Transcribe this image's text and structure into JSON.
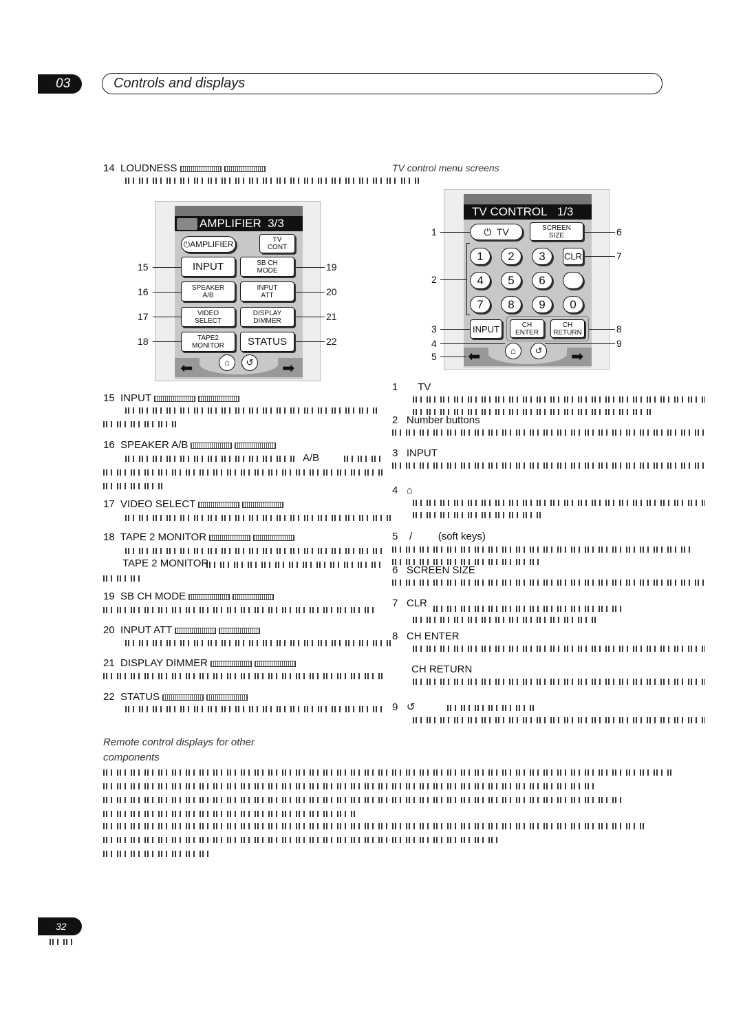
{
  "header": {
    "chapter": "03",
    "title": "Controls and displays"
  },
  "left": {
    "items": [
      {
        "num": "14",
        "label": "LOUDNESS"
      },
      {
        "num": "15",
        "label": "INPUT"
      },
      {
        "num": "16",
        "label": "SPEAKER A/B",
        "inline": "A/B"
      },
      {
        "num": "17",
        "label": "VIDEO SELECT"
      },
      {
        "num": "18",
        "label": "TAPE 2 MONITOR",
        "line2": "TAPE 2 MONITOR"
      },
      {
        "num": "19",
        "label": "SB CH MODE"
      },
      {
        "num": "20",
        "label": "INPUT ATT"
      },
      {
        "num": "21",
        "label": "DISPLAY DIMMER"
      },
      {
        "num": "22",
        "label": "STATUS"
      }
    ],
    "section_title_1": "Remote control displays for other",
    "section_title_2": "components"
  },
  "amp_screen": {
    "title": "AMPLIFIER",
    "page": "3/3",
    "power": "AMPLIFIER",
    "tv_cont_1": "TV",
    "tv_cont_2": "CONT",
    "buttons": [
      [
        "INPUT",
        ""
      ],
      [
        "SB CH",
        "MODE"
      ],
      [
        "SPEAKER",
        "A/B"
      ],
      [
        "INPUT",
        "ATT"
      ],
      [
        "VIDEO",
        "SELECT"
      ],
      [
        "DISPLAY",
        "DIMMER"
      ],
      [
        "TAPE2",
        "MONITOR"
      ],
      [
        "STATUS",
        ""
      ]
    ],
    "callouts": [
      "15",
      "16",
      "17",
      "18",
      "19",
      "20",
      "21",
      "22"
    ]
  },
  "tv_section_title": "TV control menu screens",
  "tv_screen": {
    "title": "TV CONTROL",
    "page": "1/3",
    "power": "TV",
    "screen_1": "SCREEN",
    "screen_2": "SIZE",
    "numbers": [
      "1",
      "2",
      "3",
      "CLR",
      "4",
      "5",
      "6",
      "",
      "7",
      "8",
      "9",
      "0"
    ],
    "input": "INPUT",
    "ch_enter": [
      "CH",
      "ENTER"
    ],
    "ch_return": [
      "CH",
      "RETURN"
    ],
    "callouts_left": [
      "1",
      "2",
      "3",
      "4",
      "5"
    ],
    "callouts_right": [
      "6",
      "7",
      "8",
      "9"
    ]
  },
  "right": {
    "items": [
      {
        "num": "1",
        "label": "TV"
      },
      {
        "num": "2",
        "label": "Number buttons"
      },
      {
        "num": "3",
        "label": "INPUT"
      },
      {
        "num": "4",
        "label": ""
      },
      {
        "num": "5",
        "label": "/",
        "extra": "(soft keys)"
      },
      {
        "num": "6",
        "label": "SCREEN SIZE"
      },
      {
        "num": "7",
        "label": "CLR"
      },
      {
        "num": "8",
        "label": "CH ENTER",
        "line2": "CH RETURN"
      },
      {
        "num": "9",
        "label": ""
      }
    ]
  },
  "footer": {
    "page": "32"
  }
}
